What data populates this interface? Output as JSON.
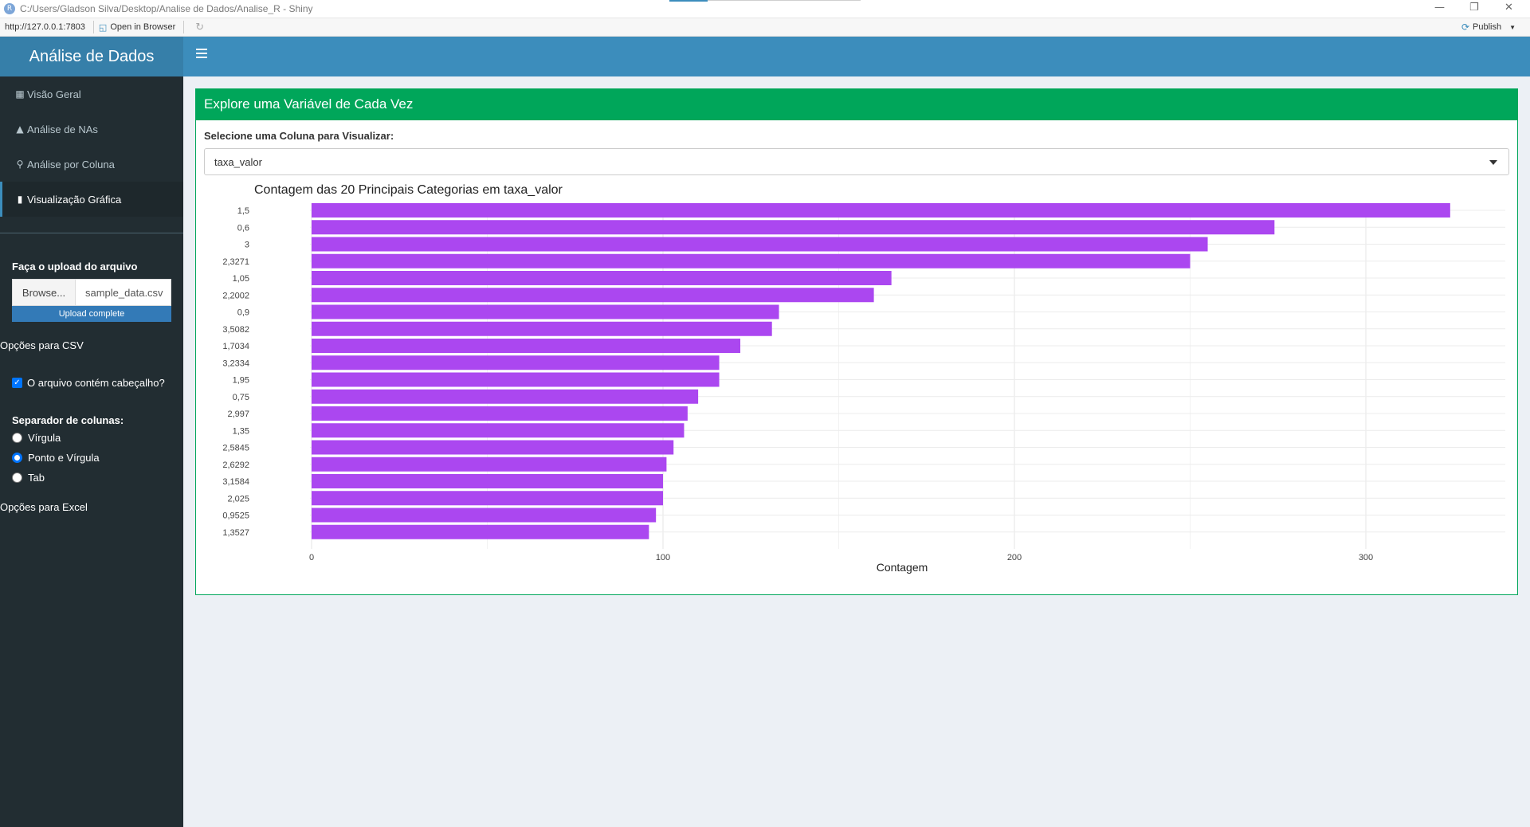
{
  "window": {
    "title": "C:/Users/Gladson Silva/Desktop/Analise de Dados/Analise_R - Shiny",
    "url": "http://127.0.0.1:7803",
    "open_in_browser": "Open in Browser",
    "publish": "Publish",
    "minimize_icon": "minimize-icon",
    "restore_icon": "restore-icon",
    "close_icon": "close-icon"
  },
  "header": {
    "app_title": "Análise de Dados"
  },
  "sidebar": {
    "items": [
      {
        "label": "Visão Geral",
        "icon": "table-icon",
        "glyph": "▦"
      },
      {
        "label": "Análise de NAs",
        "icon": "warning-icon",
        "glyph": "▲"
      },
      {
        "label": "Análise por Coluna",
        "icon": "search-plus-icon",
        "glyph": "⚲"
      },
      {
        "label": "Visualização Gráfica",
        "icon": "bar-chart-icon",
        "glyph": "▮"
      }
    ],
    "upload_label": "Faça o upload do arquivo",
    "browse_label": "Browse...",
    "file_name": "sample_data.csv",
    "upload_status": "Upload complete",
    "upload_progress": 1.0,
    "csv_options": "Opções para CSV",
    "header_checkbox": "O arquivo contém cabeçalho?",
    "header_checked": true,
    "separator_label": "Separador de colunas:",
    "separators": [
      "Vírgula",
      "Ponto e Vírgula",
      "Tab"
    ],
    "separator_selected": "Ponto e Vírgula",
    "excel_options": "Opções para Excel"
  },
  "main": {
    "box_title": "Explore uma Variável de Cada Vez",
    "select_label": "Selecione uma Coluna para Visualizar:",
    "select_value": "taxa_valor"
  },
  "chart_data": {
    "type": "bar",
    "orientation": "horizontal",
    "title": "Contagem das 20 Principais Categorias em taxa_valor",
    "xlabel": "Contagem",
    "ylabel": "",
    "xlim": [
      0,
      340
    ],
    "xticks": [
      0,
      100,
      200,
      300
    ],
    "grid": true,
    "color": "#ab47f0",
    "categories": [
      "1,5",
      "0,6",
      "3",
      "2,3271",
      "1,05",
      "2,2002",
      "0,9",
      "3,5082",
      "1,7034",
      "3,2334",
      "1,95",
      "0,75",
      "2,997",
      "1,35",
      "2,5845",
      "2,6292",
      "3,1584",
      "2,025",
      "0,9525",
      "1,3527"
    ],
    "values": [
      324,
      274,
      255,
      250,
      165,
      160,
      133,
      131,
      122,
      116,
      116,
      110,
      107,
      106,
      103,
      101,
      100,
      100,
      98,
      96
    ]
  }
}
